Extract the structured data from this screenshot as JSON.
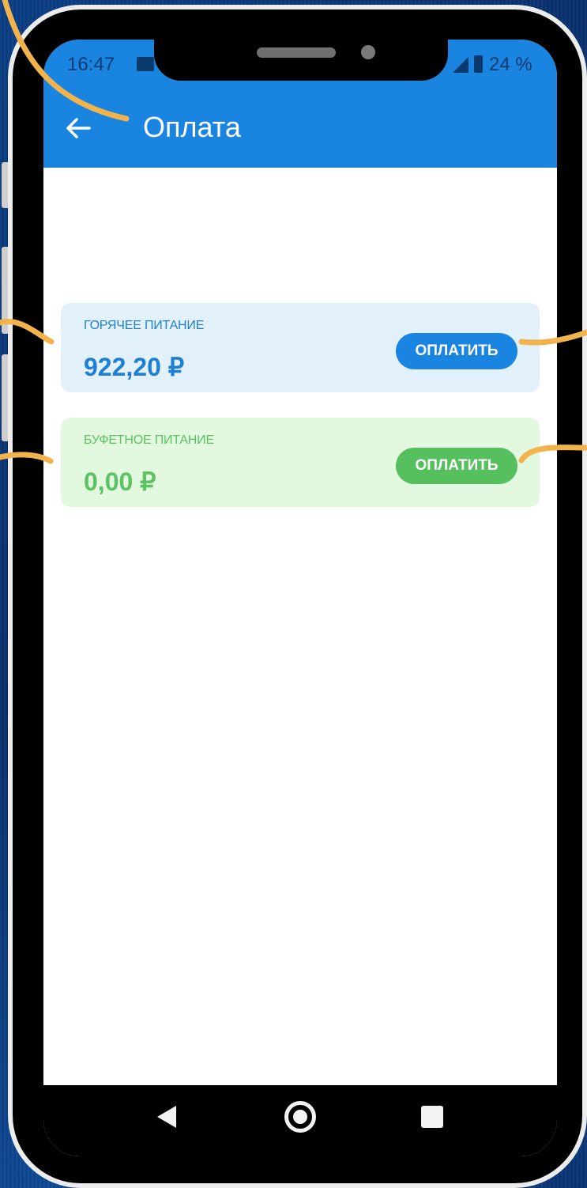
{
  "status_bar": {
    "time": "16:47",
    "battery": "24 %"
  },
  "app_bar": {
    "title": "Оплата"
  },
  "cards": [
    {
      "label": "ГОРЯЧЕЕ ПИТАНИЕ",
      "amount": "922,20 ₽",
      "button": "ОПЛАТИТЬ"
    },
    {
      "label": "БУФЕТНОЕ ПИТАНИЕ",
      "amount": "0,00 ₽",
      "button": "ОПЛАТИТЬ"
    }
  ],
  "colors": {
    "primary": "#1a84e1",
    "hot_card_bg": "#e3f1fd",
    "buffet_card_bg": "#e2f8df",
    "buffet_green": "#56c05e",
    "annotation": "#f2b24c"
  },
  "icons": {
    "back": "arrow-left-icon",
    "nav_back": "triangle-back-icon",
    "nav_home": "circle-home-icon",
    "nav_recent": "square-recent-icon"
  }
}
